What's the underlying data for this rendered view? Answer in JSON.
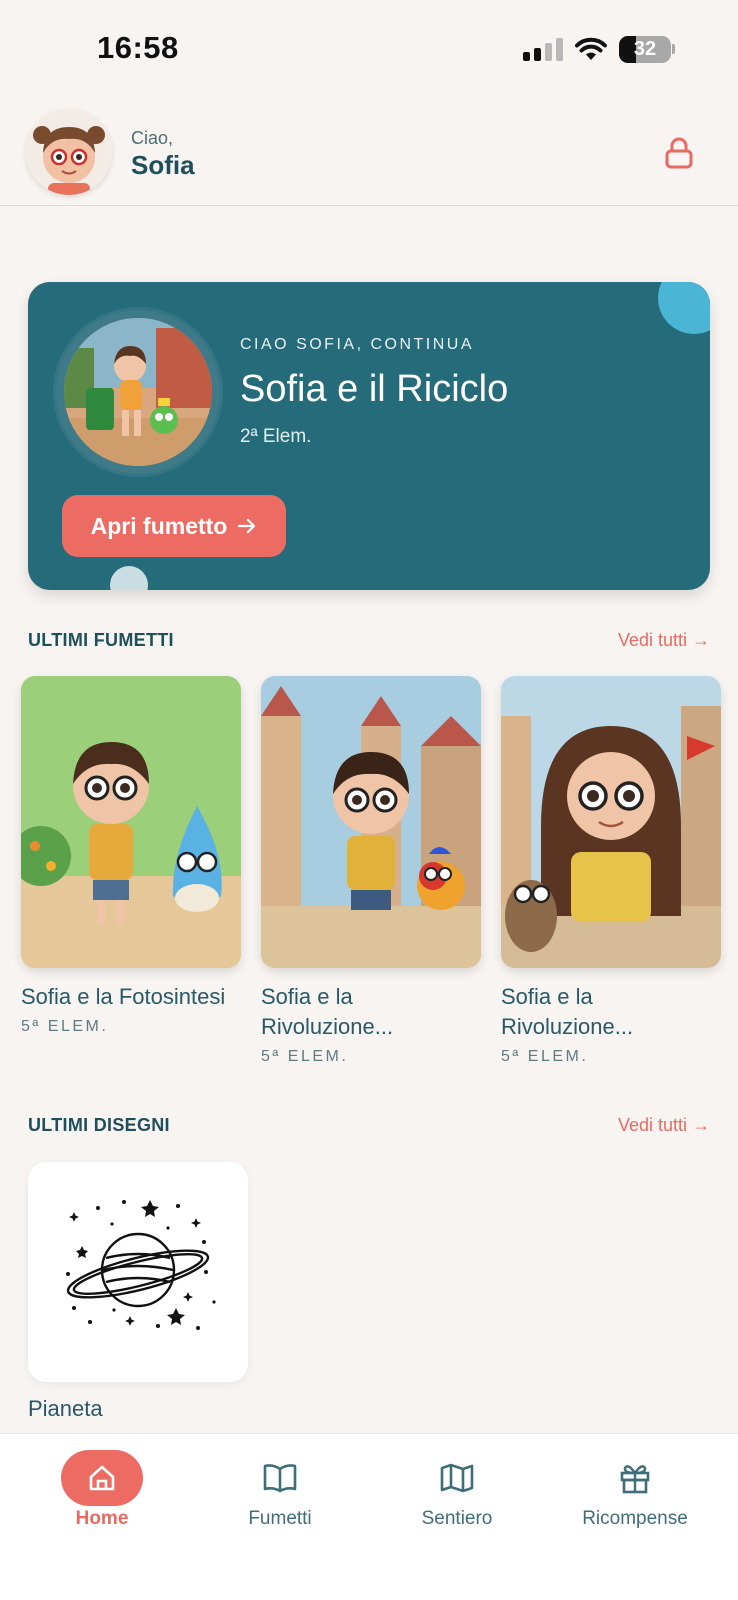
{
  "status_bar": {
    "time": "16:58",
    "battery": "32",
    "battery_level": 0.32
  },
  "header": {
    "greeting": "Ciao,",
    "user_name": "Sofia",
    "lock_icon": "lock-icon"
  },
  "hero": {
    "eyebrow": "CIAO SOFIA, CONTINUA",
    "title": "Sofia e il Riciclo",
    "grade": "2ª Elem.",
    "button_label": "Apri fumetto",
    "button_icon": "arrow-right-icon"
  },
  "comics_section": {
    "title": "ULTIMI FUMETTI",
    "see_all": "Vedi tutti →",
    "items": [
      {
        "title": "Sofia e la Fotosintesi",
        "grade": "5ª ELEM."
      },
      {
        "title": "Sofia e la Rivoluzione...",
        "grade": "5ª ELEM."
      },
      {
        "title": "Sofia e la Rivoluzione...",
        "grade": "5ª ELEM."
      }
    ]
  },
  "drawings_section": {
    "title": "ULTIMI DISEGNI",
    "see_all": "Vedi tutti →",
    "items": [
      {
        "title": "Pianeta"
      }
    ]
  },
  "nav": {
    "items": [
      {
        "label": "Home",
        "icon": "home-icon",
        "active": true
      },
      {
        "label": "Fumetti",
        "icon": "book-icon"
      },
      {
        "label": "Sentiero",
        "icon": "map-icon"
      },
      {
        "label": "Ricompense",
        "icon": "gift-icon"
      }
    ]
  },
  "colors": {
    "accent": "#ec6c64",
    "teal": "#256b7a",
    "text": "#1f4f5b",
    "background": "#f7f4f1"
  }
}
